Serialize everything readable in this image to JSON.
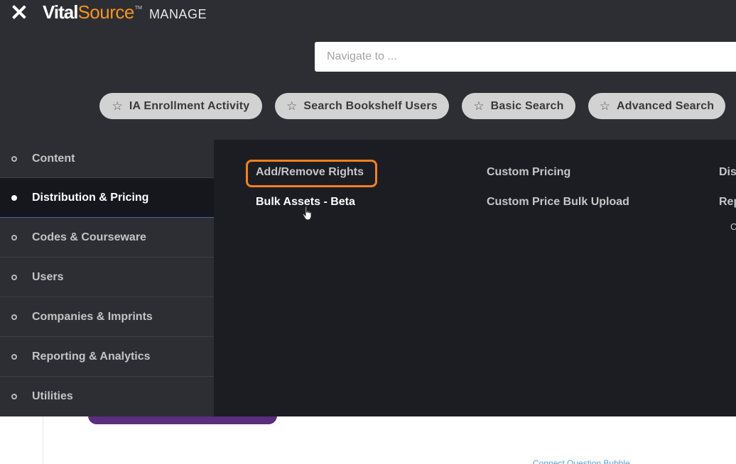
{
  "header": {
    "close_icon": "close-icon",
    "logo": {
      "vital": "Vital",
      "source": "Source",
      "tm": "TM",
      "manage": "MANAGE"
    },
    "nav_search": {
      "placeholder": "Navigate to ...",
      "value": ""
    }
  },
  "favorites": [
    {
      "icon": "star-icon",
      "label": "IA Enrollment Activity"
    },
    {
      "icon": "star-icon",
      "label": "Search Bookshelf Users"
    },
    {
      "icon": "star-icon",
      "label": "Basic Search"
    },
    {
      "icon": "star-icon",
      "label": "Advanced Search"
    }
  ],
  "sidebar": {
    "items": [
      {
        "label": "Content",
        "active": false
      },
      {
        "label": "Distribution & Pricing",
        "active": true
      },
      {
        "label": "Codes & Courseware",
        "active": false
      },
      {
        "label": "Users",
        "active": false
      },
      {
        "label": "Companies & Imprints",
        "active": false
      },
      {
        "label": "Reporting & Analytics",
        "active": false
      },
      {
        "label": "Utilities",
        "active": false
      }
    ]
  },
  "panel": {
    "col1": [
      "Add/Remove Rights",
      "Bulk Assets - Beta"
    ],
    "col2": [
      "Custom Pricing",
      "Custom Price Bulk Upload"
    ],
    "col3": [
      "Dis",
      "Rep",
      "C"
    ]
  },
  "background": {
    "link_text": "Connect Question Bubble"
  },
  "colors": {
    "header_bg": "#2d2e33",
    "panel_bg": "#1c1d23",
    "accent_orange": "#f4801f",
    "brand_orange": "#f7941d"
  }
}
